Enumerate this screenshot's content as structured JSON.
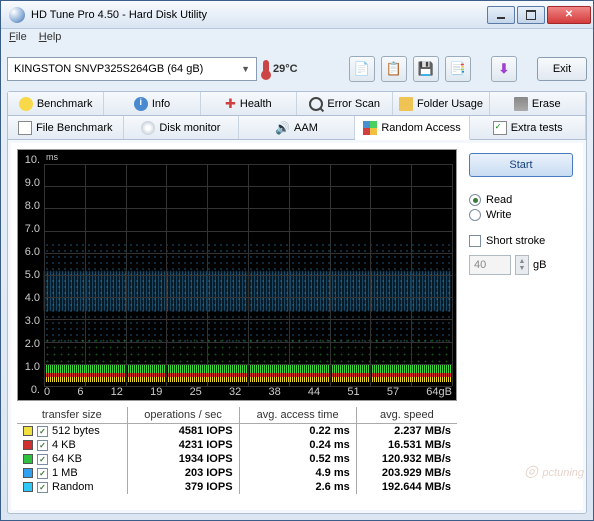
{
  "window": {
    "title": "HD Tune Pro 4.50 - Hard Disk Utility"
  },
  "menu": {
    "file": "File",
    "help": "Help"
  },
  "toolbar": {
    "drive": "KINGSTON SNVP325S264GB (64 gB)",
    "temperature": "29°C",
    "exit": "Exit"
  },
  "tabs_row1": [
    "Benchmark",
    "Info",
    "Health",
    "Error Scan",
    "Folder Usage",
    "Erase"
  ],
  "tabs_row2": [
    "File Benchmark",
    "Disk monitor",
    "AAM",
    "Random Access",
    "Extra tests"
  ],
  "active_tab": "Random Access",
  "controls": {
    "start": "Start",
    "read": "Read",
    "write": "Write",
    "short_stroke": "Short stroke",
    "stroke_value": "40",
    "stroke_unit": "gB"
  },
  "chart_data": {
    "type": "scatter",
    "xlabel": "gB",
    "ylabel": "ms",
    "x_ticks": [
      "0",
      "6",
      "12",
      "19",
      "25",
      "32",
      "38",
      "44",
      "51",
      "57",
      "64gB"
    ],
    "y_ticks": [
      "10.",
      "9.0",
      "8.0",
      "7.0",
      "6.0",
      "5.0",
      "4.0",
      "3.0",
      "2.0",
      "1.0",
      "0."
    ],
    "xlim": [
      0,
      64
    ],
    "ylim": [
      0,
      10
    ],
    "series": [
      {
        "name": "512 bytes",
        "color": "#f0e040",
        "approx_ms": 0.22
      },
      {
        "name": "4 KB",
        "color": "#d03030",
        "approx_ms": 0.24
      },
      {
        "name": "64 KB",
        "color": "#30c040",
        "approx_ms": 0.52
      },
      {
        "name": "1 MB",
        "color": "#30a0f0",
        "approx_ms": 4.9
      },
      {
        "name": "Random",
        "color": "#30c8f8",
        "approx_ms": 2.6
      }
    ]
  },
  "results": {
    "headers": [
      "transfer size",
      "operations / sec",
      "avg. access time",
      "avg. speed"
    ],
    "rows": [
      {
        "color": "#f0e040",
        "label": "512 bytes",
        "iops": "4581 IOPS",
        "time": "0.22 ms",
        "speed": "2.237 MB/s",
        "checked": true
      },
      {
        "color": "#d03030",
        "label": "4 KB",
        "iops": "4231 IOPS",
        "time": "0.24 ms",
        "speed": "16.531 MB/s",
        "checked": true
      },
      {
        "color": "#30c040",
        "label": "64 KB",
        "iops": "1934 IOPS",
        "time": "0.52 ms",
        "speed": "120.932 MB/s",
        "checked": true
      },
      {
        "color": "#30a0f0",
        "label": "1 MB",
        "iops": "203 IOPS",
        "time": "4.9 ms",
        "speed": "203.929 MB/s",
        "checked": true
      },
      {
        "color": "#30c8f8",
        "label": "Random",
        "iops": "379 IOPS",
        "time": "2.6 ms",
        "speed": "192.644 MB/s",
        "checked": true
      }
    ]
  },
  "watermark": "pctuning"
}
